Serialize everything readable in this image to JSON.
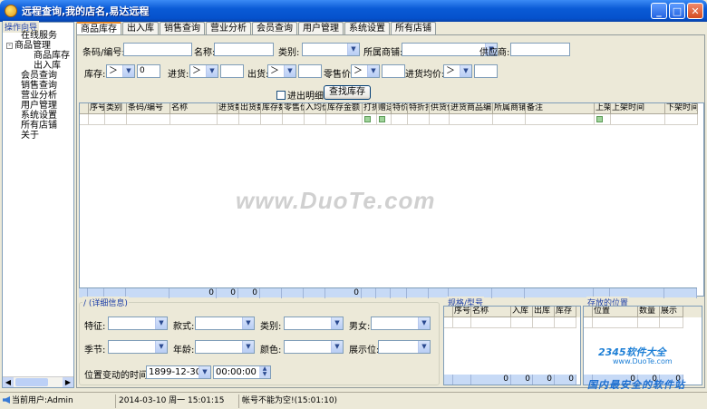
{
  "window": {
    "title": "远程查询,我的店名,易达远程"
  },
  "sidebar": {
    "title": "操作向导",
    "items": [
      {
        "label": "在线服务",
        "indent": 1,
        "toggle": ""
      },
      {
        "label": "商品管理",
        "indent": 0,
        "toggle": "-"
      },
      {
        "label": "商品库存",
        "indent": 2,
        "toggle": ""
      },
      {
        "label": "出入库",
        "indent": 2,
        "toggle": ""
      },
      {
        "label": "会员查询",
        "indent": 1,
        "toggle": ""
      },
      {
        "label": "销售查询",
        "indent": 1,
        "toggle": ""
      },
      {
        "label": "营业分析",
        "indent": 1,
        "toggle": ""
      },
      {
        "label": "用户管理",
        "indent": 1,
        "toggle": ""
      },
      {
        "label": "系统设置",
        "indent": 1,
        "toggle": ""
      },
      {
        "label": "所有店铺",
        "indent": 1,
        "toggle": ""
      },
      {
        "label": "关于",
        "indent": 1,
        "toggle": ""
      }
    ]
  },
  "tabs": [
    "商品库存",
    "出入库",
    "销售查询",
    "营业分析",
    "会员查询",
    "用户管理",
    "系统设置",
    "所有店铺"
  ],
  "search": {
    "barcode_label": "条码/编号:",
    "name_label": "名称:",
    "category_label": "类别:",
    "store_label": "所属商铺:",
    "supplier_label": "供应商:",
    "stock_label": "库存:",
    "stock_op": "＞",
    "stock_value": "0",
    "in_label": "进货:",
    "in_op": "＞",
    "out_label": "出货:",
    "out_op": "＞",
    "retail_label": "零售价:",
    "retail_op": "＞",
    "avg_label": "进货均价:",
    "avg_op": "＞",
    "detail_checkbox": "进出明细",
    "search_button": "查找库存"
  },
  "grid": {
    "columns": [
      "序号",
      "类别",
      "条码/编号",
      "名称",
      "进货数",
      "出货数",
      "库存数",
      "零售价",
      "入均价",
      "库存金额",
      "打折",
      "赠送",
      "特价",
      "特折扣",
      "供货价",
      "进货商品编",
      "所属商铺",
      "备注",
      "上架",
      "上架时间",
      "下架时间"
    ],
    "footer": [
      "",
      "",
      "",
      "0",
      "0",
      "0",
      "",
      "",
      "",
      "0",
      "",
      "",
      "",
      "",
      "",
      "",
      "",
      "",
      "",
      "",
      ""
    ]
  },
  "detail": {
    "title": "/ (详细信息)",
    "spec_label": "特征:",
    "style_label": "款式:",
    "category_label": "类别:",
    "gender_label": "男女:",
    "season_label": "季节:",
    "age_label": "年龄:",
    "color_label": "颜色:",
    "display_label": "展示位:",
    "pos_time_label": "位置变动的时间:",
    "pos_date": "1899-12-30",
    "pos_time": "00:00:00"
  },
  "spec_grid": {
    "title": "规格/型号",
    "columns": [
      "序号",
      "名称",
      "入库",
      "出库",
      "库存"
    ],
    "footer": [
      "",
      "0",
      "0",
      "0",
      "0"
    ]
  },
  "location_grid": {
    "title": "存放的位置",
    "columns": [
      "位置",
      "数量",
      "展示"
    ],
    "footer": [
      "0",
      "0",
      "0"
    ]
  },
  "watermark": {
    "text": "www.DuoTe.com",
    "brand_2345": "2345软件大全",
    "brand_2345_url": "www.DuoTe.com",
    "brand_bottom": "国内最安全的软件站"
  },
  "status": {
    "user": "当前用户:Admin",
    "datetime": "2014-03-10 周一 15:01:15",
    "message": "帐号不能为空!(15:01:10)"
  }
}
